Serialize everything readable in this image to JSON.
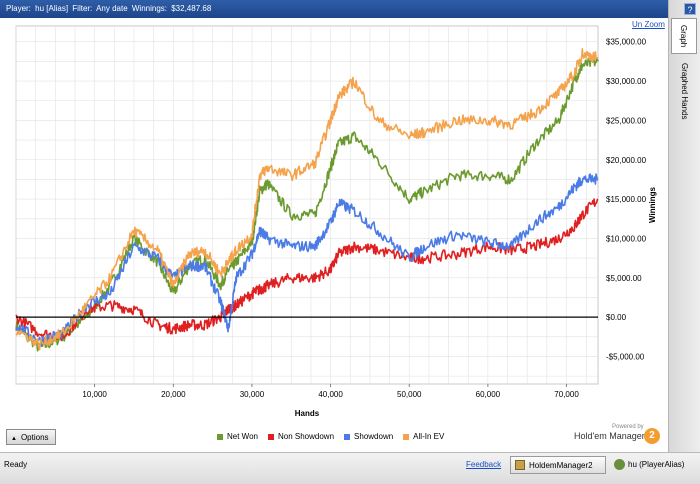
{
  "header": {
    "player_label": "Player:",
    "player_value": "hu [Alias]",
    "filter_label": "Filter:",
    "filter_value": "Any date",
    "winnings_label": "Winnings:",
    "winnings_value": "$32,487.68",
    "help_label": "?"
  },
  "tabs": [
    {
      "label": "Graph",
      "active": true
    },
    {
      "label": "Graphed Hands",
      "active": false
    }
  ],
  "unzoom_label": "Un Zoom",
  "options_label": "Options",
  "branding": {
    "powered_by": "Powered by",
    "name": "Hold'em Manager",
    "logo": "2"
  },
  "status": {
    "ready": "Ready",
    "feedback": "Feedback",
    "task_app": "HoldemManager2",
    "task_user": "hu (PlayerAlias)"
  },
  "colors": {
    "net_won": "#6b9a2e",
    "non_showdown": "#e02020",
    "showdown": "#4b7be6",
    "all_in_ev": "#f4a24c",
    "zero_line": "#000000",
    "grid": "#e2e2e2"
  },
  "chart_data": {
    "type": "line",
    "xlabel": "Hands",
    "ylabel": "Winnings",
    "xlim": [
      0,
      74000
    ],
    "ylim": [
      -8500,
      37000
    ],
    "x_ticks": [
      10000,
      20000,
      30000,
      40000,
      50000,
      60000,
      70000
    ],
    "x_tick_labels": [
      "10,000",
      "20,000",
      "30,000",
      "40,000",
      "50,000",
      "60,000",
      "70,000"
    ],
    "y_ticks": [
      -5000,
      0,
      5000,
      10000,
      15000,
      20000,
      25000,
      30000,
      35000
    ],
    "y_tick_labels": [
      "-$5,000.00",
      "$0.00",
      "$5,000.00",
      "$10,000.00",
      "$15,000.00",
      "$20,000.00",
      "$25,000.00",
      "$30,000.00",
      "$35,000.00"
    ],
    "grid": true,
    "legend_position": "bottom",
    "x": [
      0,
      3000,
      6000,
      9000,
      12000,
      15000,
      18000,
      20000,
      22000,
      24000,
      26000,
      27000,
      28000,
      30000,
      31000,
      32000,
      35000,
      38000,
      40000,
      41000,
      43000,
      46000,
      50000,
      52000,
      56000,
      60000,
      63000,
      66000,
      69000,
      71000,
      72000,
      74000
    ],
    "series": [
      {
        "name": "Net Won",
        "color_key": "net_won",
        "values": [
          -1000,
          -4000,
          -2500,
          0,
          4000,
          10000,
          7000,
          3000,
          6500,
          7500,
          4000,
          6000,
          7000,
          9500,
          16000,
          17000,
          13000,
          13000,
          19000,
          22000,
          23000,
          20000,
          15000,
          16000,
          18000,
          18000,
          17500,
          22000,
          25000,
          30000,
          32000,
          32500
        ]
      },
      {
        "name": "Non Showdown",
        "color_key": "non_showdown",
        "values": [
          0,
          -2000,
          -2500,
          1000,
          1500,
          1000,
          -1000,
          -1500,
          -1000,
          -1000,
          0,
          1000,
          1500,
          3000,
          3500,
          4000,
          5000,
          5000,
          6000,
          8000,
          9000,
          8500,
          7500,
          7500,
          8000,
          9000,
          8500,
          9000,
          10000,
          11500,
          13000,
          15000
        ]
      },
      {
        "name": "Showdown",
        "color_key": "showdown",
        "values": [
          -1000,
          -3000,
          -2000,
          1500,
          3000,
          9000,
          7500,
          5000,
          6500,
          6500,
          2000,
          -1500,
          5000,
          8000,
          11000,
          10000,
          9000,
          9000,
          12000,
          14500,
          13500,
          11000,
          7500,
          9000,
          10500,
          9500,
          9000,
          12000,
          14000,
          16500,
          17500,
          17500
        ]
      },
      {
        "name": "All-In EV",
        "color_key": "all_in_ev",
        "values": [
          -1500,
          -3500,
          -2000,
          1500,
          5000,
          11000,
          8500,
          4000,
          8000,
          8500,
          5500,
          7000,
          8500,
          10500,
          18000,
          19000,
          18000,
          19500,
          25000,
          28000,
          30000,
          25000,
          23000,
          23500,
          25000,
          25000,
          24500,
          26000,
          28500,
          31000,
          33500,
          33000
        ]
      }
    ]
  }
}
